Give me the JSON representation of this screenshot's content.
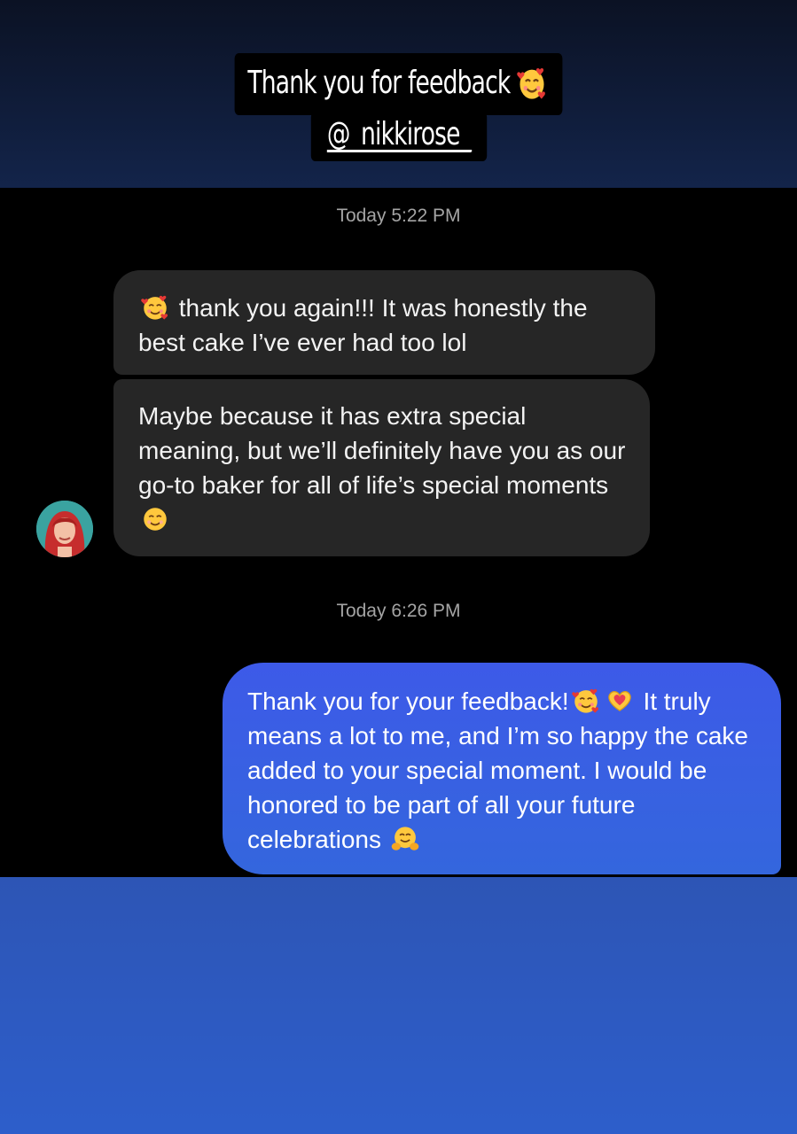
{
  "story": {
    "caption_line1": "Thank you for feedback",
    "caption_line2": "@_nikkirose_",
    "caption_emoji": "smiling-face-with-hearts-icon"
  },
  "chat": {
    "timestamp_1": "Today 5:22 PM",
    "timestamp_2": "Today 6:26 PM",
    "received": [
      {
        "text_line1": "thank you again!!! It was honestly the",
        "text_line2": "best cake I’ve ever had too lol",
        "emoji": "smiling-face-with-hearts-icon"
      },
      {
        "text": "Maybe because it has extra special meaning, but we’ll definitely have you as our go-to baker for all of life’s special moments",
        "emoji": "smiling-face-icon"
      }
    ],
    "sent": {
      "text_part1": "Thank you for your feedback!",
      "text_part2": "It truly means a lot to me, and I’m so happy the cake added to your special moment. I would be honored to be part of all your future celebrations",
      "emojis": [
        "smiling-face-with-hearts-icon",
        "heart-hands-icon",
        "hugging-face-icon"
      ]
    }
  },
  "colors": {
    "received_bubble": "#262626",
    "sent_bubble": "#3a5fe5",
    "timestamp": "#a4a4a4",
    "bottom_background": "#2d5ecb"
  }
}
